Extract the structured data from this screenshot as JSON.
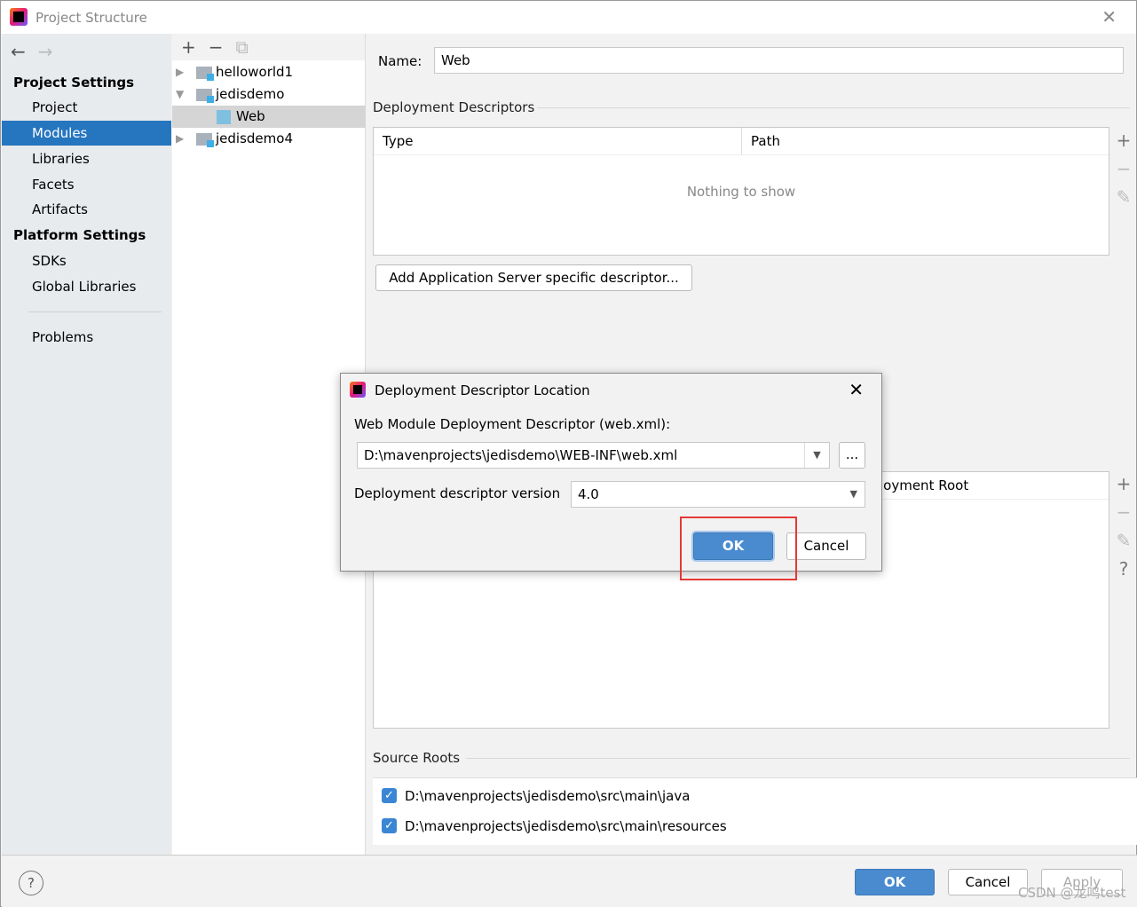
{
  "window": {
    "title": "Project Structure",
    "close_icon": "close-icon"
  },
  "sidebar": {
    "project_settings": "Project Settings",
    "project_items": [
      "Project",
      "Modules",
      "Libraries",
      "Facets",
      "Artifacts"
    ],
    "selected": "Modules",
    "platform_settings": "Platform Settings",
    "platform_items": [
      "SDKs",
      "Global Libraries"
    ],
    "problems": "Problems"
  },
  "tree": {
    "nodes": [
      {
        "label": "helloworld1",
        "expanded": false
      },
      {
        "label": "jedisdemo",
        "expanded": true
      },
      {
        "label": "Web",
        "selected": true
      },
      {
        "label": "jedisdemo4",
        "expanded": false
      }
    ]
  },
  "main": {
    "name_label": "Name:",
    "name_value": "Web",
    "deployment_descriptors": "Deployment Descriptors",
    "col_type": "Type",
    "col_path": "Path",
    "empty": "Nothing to show",
    "add_descriptor": "Add Application Server specific descriptor...",
    "deployment_root": "loyment Root",
    "source_roots": "Source Roots",
    "roots": [
      {
        "path": "D:\\mavenprojects\\jedisdemo\\src\\main\\java",
        "checked": true
      },
      {
        "path": "D:\\mavenprojects\\jedisdemo\\src\\main\\resources",
        "checked": true
      }
    ]
  },
  "dialog": {
    "title": "Deployment Descriptor Location",
    "descriptor_label": "Web Module Deployment Descriptor (web.xml):",
    "descriptor_value": "D:\\mavenprojects\\jedisdemo\\WEB-INF\\web.xml",
    "browse": "...",
    "version_label": "Deployment descriptor version",
    "version_value": "4.0",
    "ok": "OK",
    "cancel": "Cancel",
    "highlight_color": "#e53935"
  },
  "footer": {
    "help": "?",
    "ok": "OK",
    "cancel": "Cancel",
    "apply": "Apply"
  },
  "watermark": "CSDN @龙鸣test"
}
